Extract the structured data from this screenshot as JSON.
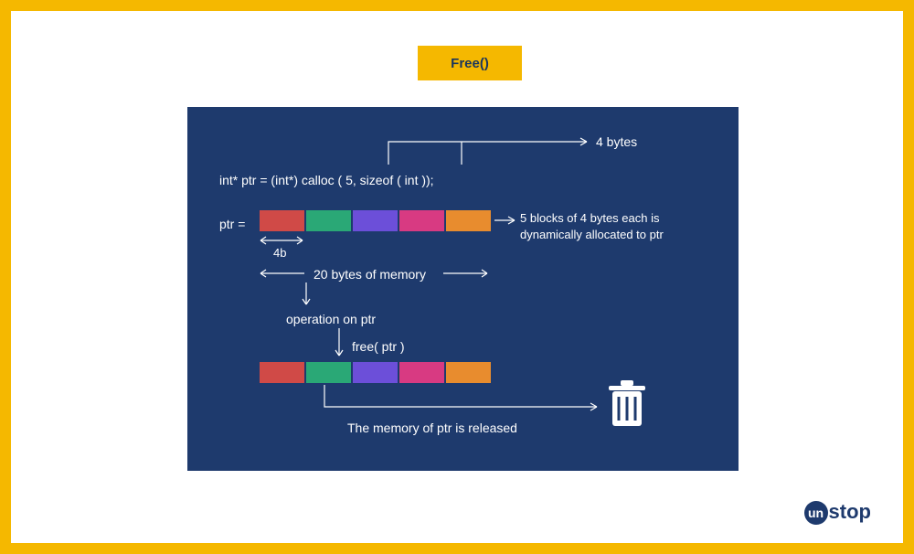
{
  "title": "Free()",
  "code_line": "int* ptr = (int*) calloc ( 5, sizeof ( int ));",
  "ptr_equals": "ptr =",
  "label_4bytes": "4 bytes",
  "label_blocks_desc_line1": "5 blocks of 4 bytes each is",
  "label_blocks_desc_line2": "dynamically allocated to ptr",
  "label_4b": "4b",
  "label_20bytes": "20 bytes of memory",
  "label_operation": "operation on ptr",
  "label_freeptr": "free( ptr )",
  "label_released": "The memory of ptr is released",
  "block_colors": [
    "c-red",
    "c-green",
    "c-purple",
    "c-pink",
    "c-orange"
  ],
  "logo_un": "un",
  "logo_stop": "stop"
}
